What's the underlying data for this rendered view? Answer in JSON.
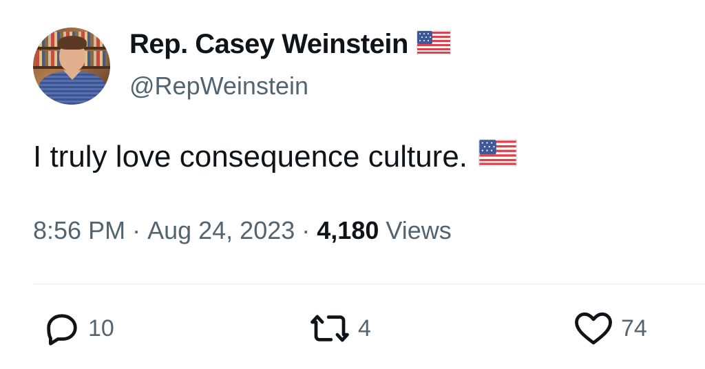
{
  "tweet": {
    "author": {
      "display_name": "Rep. Casey Weinstein",
      "handle": "@RepWeinstein",
      "avatar_icon": "profile-photo",
      "name_badge_icon": "us-flag-emoji"
    },
    "text": "I truly love consequence culture.",
    "text_emoji_icon": "us-flag-emoji",
    "time": "8:56 PM",
    "date": "Aug 24, 2023",
    "separator": "·",
    "views_count": "4,180",
    "views_label": "Views",
    "actions": {
      "reply": {
        "icon": "reply-icon",
        "count": "10"
      },
      "retweet": {
        "icon": "retweet-icon",
        "count": "4"
      },
      "like": {
        "icon": "heart-icon",
        "count": "74"
      }
    }
  },
  "colors": {
    "primary_text": "#0f1419",
    "secondary_text": "#536471",
    "divider": "#e6e9ec",
    "background": "#ffffff"
  }
}
